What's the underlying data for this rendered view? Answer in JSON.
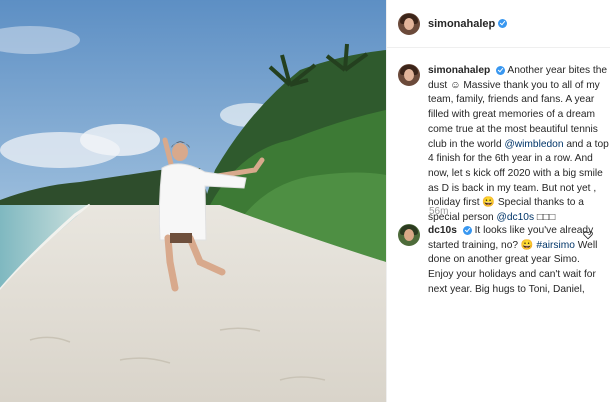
{
  "post": {
    "username": "simonahalep",
    "caption_parts": [
      "Another year bites the dust ☺ Massive thank you to all of my team, family, friends and fans. A year filled with great memories of a dream come true at the most beautiful tennis club in the world ",
      "@wimbledon",
      " and a top 4 finish for the 6th year in a row. And now, let s kick off 2020 with a big smile as D is back in my team. But not yet , holiday first 😀 Special thanks to a special person ",
      "@dc10s",
      " □□□"
    ],
    "time_ago": "56m"
  },
  "reply": {
    "username": "dc10s",
    "text_parts": [
      "It looks like you've already started training, no? 😀 ",
      "#airsimo",
      " Well done on another great year Simo. Enjoy your holidays and can't wait for next year. Big hugs to Toni, Daniel,"
    ]
  },
  "icons": {
    "verified": "verified-badge-icon",
    "like": "heart-icon"
  },
  "colors": {
    "verified": "#3897f0",
    "mention": "#003569",
    "timestamp": "#999999"
  }
}
